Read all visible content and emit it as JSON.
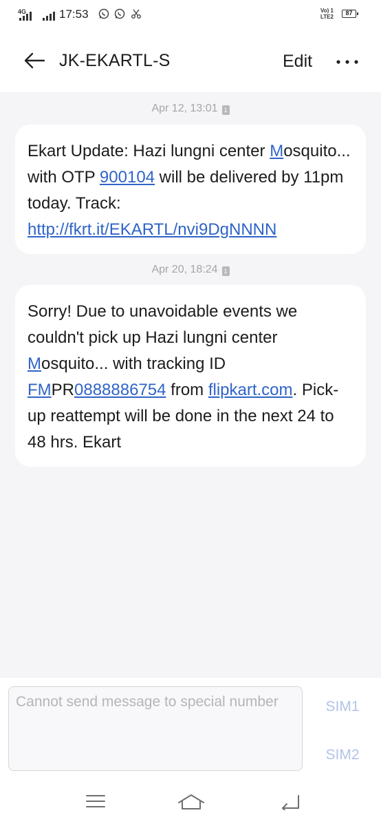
{
  "status_bar": {
    "network": "4G",
    "time": "17:53",
    "volte_line1": "Vo) 1",
    "volte_line2": "LTE2",
    "battery": "87",
    "icons": [
      "signal-icon",
      "signal-icon",
      "whatsapp-icon",
      "whatsapp-icon",
      "scissors-icon"
    ]
  },
  "header": {
    "title": "JK-EKARTL-S",
    "edit_label": "Edit",
    "icons": [
      "back-arrow-icon",
      "more-dots-icon"
    ]
  },
  "messages": [
    {
      "timestamp": "Apr 12, 13:01",
      "sim_badge": "1",
      "parts": {
        "p1": "Ekart Update: Hazi lungni center ",
        "l1": "M",
        "p2": "osquito... with OTP ",
        "l2": "900104",
        "p3": "  will be delivered by 11pm today.  Track: ",
        "l3": "http://fkrt.it/EKARTL/nvi9DgNNNN"
      }
    },
    {
      "timestamp": "Apr 20, 18:24",
      "sim_badge": "1",
      "parts": {
        "p1": "Sorry! Due to unavoidable events we couldn't pick up Hazi lungni center ",
        "l1": "M",
        "p2": "osquito... with tracking ID ",
        "l2": "FM",
        "p3": "PR",
        "l3": "0888886754",
        "p4": " from ",
        "l4": "flipkart.com",
        "p5": ". Pick-up reattempt will be done in the next 24 to 48 hrs. Ekart"
      }
    }
  ],
  "composer": {
    "placeholder": "Cannot send message to special number",
    "sim1_label": "SIM1",
    "sim2_label": "SIM2"
  },
  "nav_bar": {
    "icons": [
      "menu-icon",
      "home-icon",
      "back-icon"
    ]
  },
  "colors": {
    "link": "#2f64c7",
    "background": "#f5f5f7",
    "bubble": "#ffffff",
    "sim_button": "#b3c3e8"
  }
}
